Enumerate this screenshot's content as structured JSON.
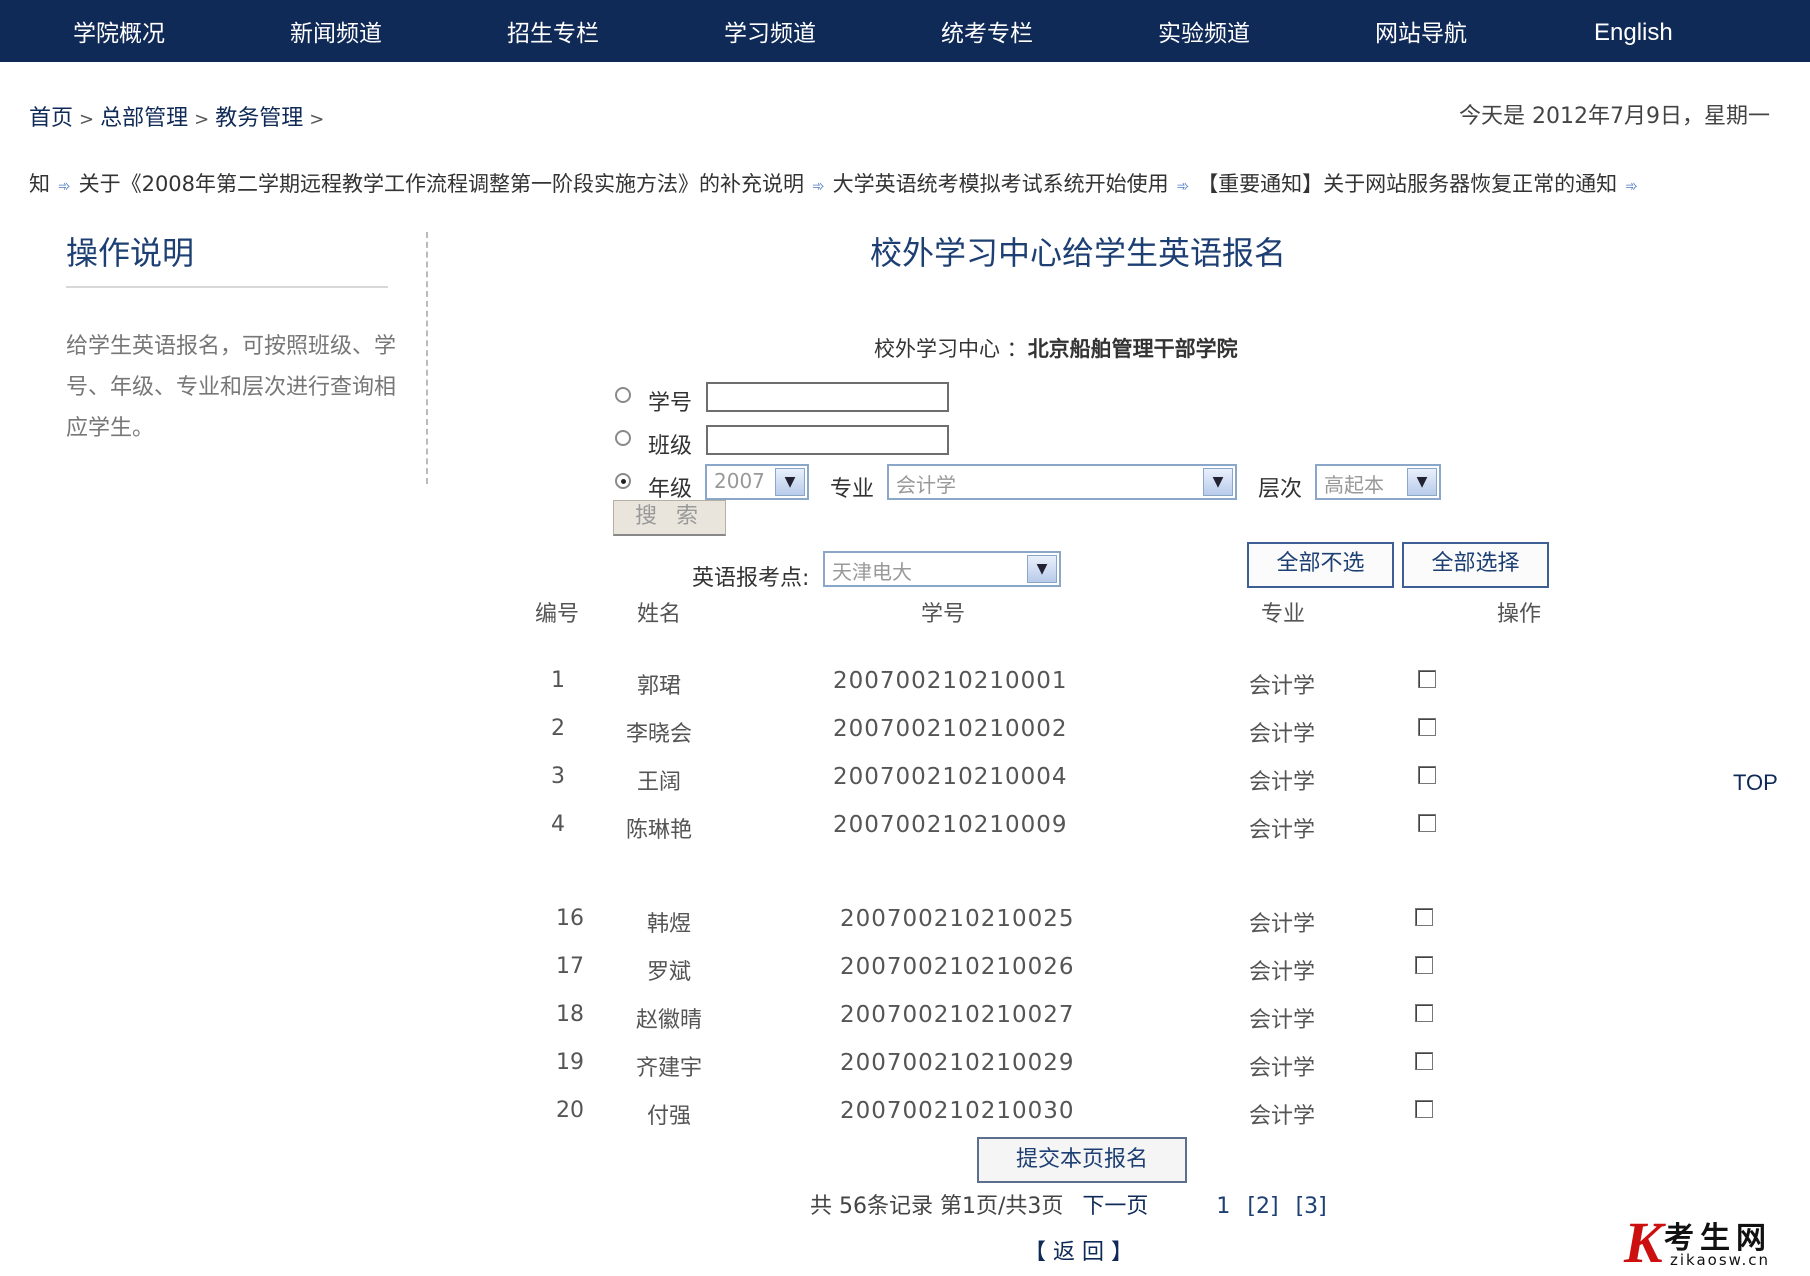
{
  "nav": {
    "items": [
      "学院概况",
      "新闻频道",
      "招生专栏",
      "学习频道",
      "统考专栏",
      "实验频道",
      "网站导航",
      "English"
    ]
  },
  "breadcrumb": {
    "home": "首页",
    "level1": "总部管理",
    "level2": "教务管理",
    "sep": ">"
  },
  "today": "今天是 2012年7月9日，星期一",
  "ticker": {
    "lead": "知",
    "items": [
      "关于《2008年第二学期远程教学工作流程调整第一阶段实施方法》的补充说明",
      "大学英语统考模拟考试系统开始使用",
      "【重要通知】关于网站服务器恢复正常的通知"
    ]
  },
  "sidebar": {
    "title": "操作说明",
    "text": "给学生英语报名，可按照班级、学号、年级、专业和层次进行查询相应学生。"
  },
  "main": {
    "title": "校外学习中心给学生英语报名",
    "center_label": "校外学习中心 ：",
    "center_name": "北京船舶管理干部学院"
  },
  "search": {
    "student_no_label": "学号",
    "class_label": "班级",
    "grade_label": "年级",
    "grade_value": "2007",
    "major_label": "专业",
    "major_value": "会计学",
    "level_label": "层次",
    "level_value": "高起本",
    "search_button": "搜 索",
    "selected_option": "年级"
  },
  "exam_site": {
    "label": "英语报考点:",
    "value": "天津电大"
  },
  "buttons": {
    "deselect_all": "全部不选",
    "select_all": "全部选择",
    "submit": "提交本页报名"
  },
  "table": {
    "headers": [
      "编号",
      "姓名",
      "学号",
      "专业",
      "操作"
    ],
    "rows": [
      {
        "no": "1",
        "name": "郭珺",
        "sid": "200700210210001",
        "major": "会计学"
      },
      {
        "no": "2",
        "name": "李晓会",
        "sid": "200700210210002",
        "major": "会计学"
      },
      {
        "no": "3",
        "name": "王阔",
        "sid": "200700210210004",
        "major": "会计学"
      },
      {
        "no": "4",
        "name": "陈琳艳",
        "sid": "200700210210009",
        "major": "会计学"
      },
      {
        "no": "16",
        "name": "韩煜",
        "sid": "200700210210025",
        "major": "会计学"
      },
      {
        "no": "17",
        "name": "罗斌",
        "sid": "200700210210026",
        "major": "会计学"
      },
      {
        "no": "18",
        "name": "赵徽晴",
        "sid": "200700210210027",
        "major": "会计学"
      },
      {
        "no": "19",
        "name": "齐建宇",
        "sid": "200700210210029",
        "major": "会计学"
      },
      {
        "no": "20",
        "name": "付强",
        "sid": "200700210210030",
        "major": "会计学"
      }
    ]
  },
  "pager": {
    "summary": "共 56条记录 第1页/共3页",
    "next": "下一页",
    "pages": [
      "1",
      "[2]",
      "[3]"
    ]
  },
  "back": "【 返 回 】",
  "top": "TOP",
  "logo": {
    "mark": "K",
    "cn": "考生网",
    "en": "zikaosw.cn"
  }
}
